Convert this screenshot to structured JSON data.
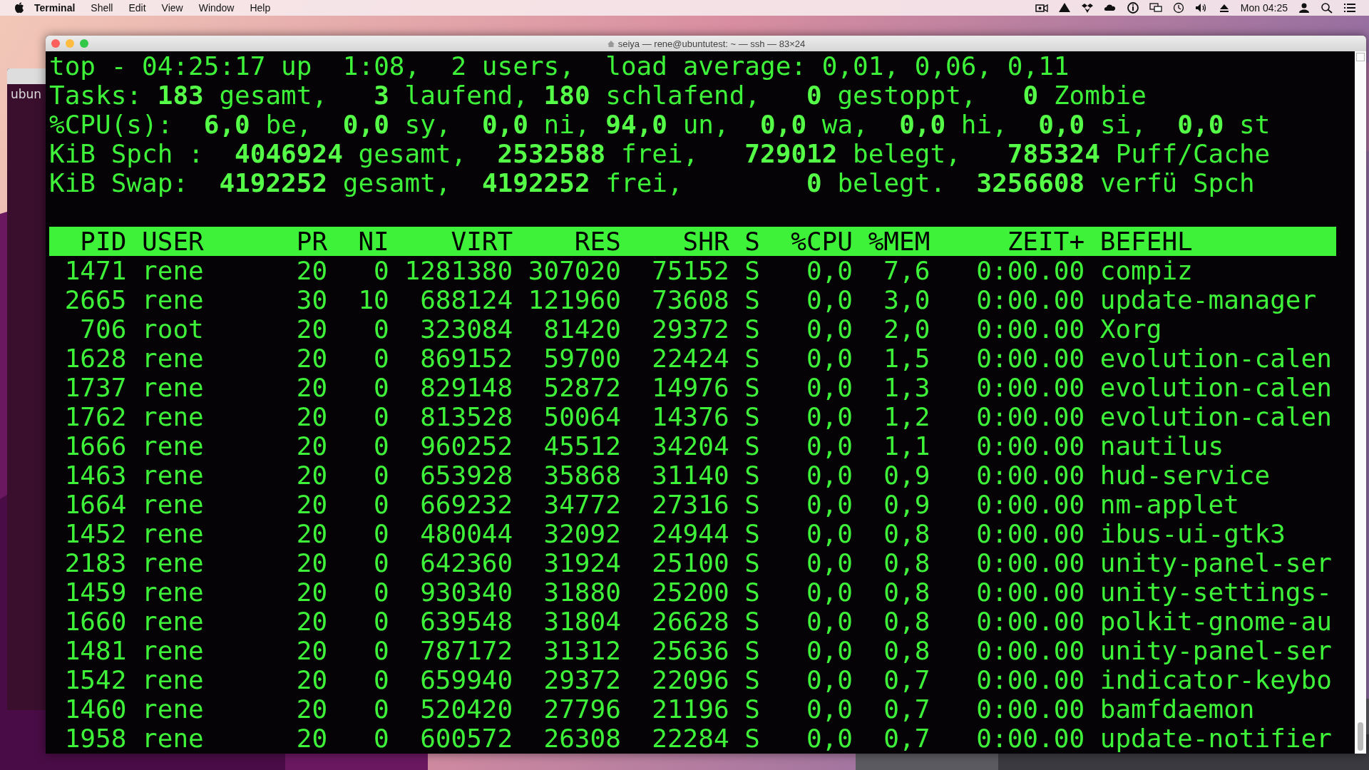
{
  "menu_bar": {
    "app": "Terminal",
    "items": [
      "Shell",
      "Edit",
      "View",
      "Window",
      "Help"
    ],
    "clock": "Mon 04:25"
  },
  "background_window": {
    "text": "ubun"
  },
  "window": {
    "title": "seiya — rene@ubuntutest: ~ — ssh — 83×24"
  },
  "summary": [
    "top - 04:25:17 up  1:08,  2 users,  load average: 0,01, 0,06, 0,11",
    "Tasks: **183** gesamt,   **3** laufend, **180** schlafend,   **0** gestoppt,   **0** Zombie",
    "%CPU(s):  **6,0** be,  **0,0** sy,  **0,0** ni, **94,0** un,  **0,0** wa,  **0,0** hi,  **0,0** si,  **0,0** st",
    "KiB Spch :  **4046924** gesamt,  **2532588** frei,   **729012** belegt,   **785324** Puff/Cache",
    "KiB Swap:  **4192252** gesamt,  **4192252** frei,        **0** belegt.  **3256608** verfü Spch"
  ],
  "table": {
    "columns": [
      "PID",
      "USER",
      "PR",
      "NI",
      "VIRT",
      "RES",
      "SHR",
      "S",
      "%CPU",
      "%MEM",
      "ZEIT+",
      "BEFEHL"
    ],
    "rows": [
      [
        "1471",
        "rene",
        "20",
        "0",
        "1281380",
        "307020",
        "75152",
        "S",
        "0,0",
        "7,6",
        "0:00.00",
        "compiz"
      ],
      [
        "2665",
        "rene",
        "30",
        "10",
        "688124",
        "121960",
        "73608",
        "S",
        "0,0",
        "3,0",
        "0:00.00",
        "update-manager"
      ],
      [
        "706",
        "root",
        "20",
        "0",
        "323084",
        "81420",
        "29372",
        "S",
        "0,0",
        "2,0",
        "0:00.00",
        "Xorg"
      ],
      [
        "1628",
        "rene",
        "20",
        "0",
        "869152",
        "59700",
        "22424",
        "S",
        "0,0",
        "1,5",
        "0:00.00",
        "evolution-calen"
      ],
      [
        "1737",
        "rene",
        "20",
        "0",
        "829148",
        "52872",
        "14976",
        "S",
        "0,0",
        "1,3",
        "0:00.00",
        "evolution-calen"
      ],
      [
        "1762",
        "rene",
        "20",
        "0",
        "813528",
        "50064",
        "14376",
        "S",
        "0,0",
        "1,2",
        "0:00.00",
        "evolution-calen"
      ],
      [
        "1666",
        "rene",
        "20",
        "0",
        "960252",
        "45512",
        "34204",
        "S",
        "0,0",
        "1,1",
        "0:00.00",
        "nautilus"
      ],
      [
        "1463",
        "rene",
        "20",
        "0",
        "653928",
        "35868",
        "31140",
        "S",
        "0,0",
        "0,9",
        "0:00.00",
        "hud-service"
      ],
      [
        "1664",
        "rene",
        "20",
        "0",
        "669232",
        "34772",
        "27316",
        "S",
        "0,0",
        "0,9",
        "0:00.00",
        "nm-applet"
      ],
      [
        "1452",
        "rene",
        "20",
        "0",
        "480044",
        "32092",
        "24944",
        "S",
        "0,0",
        "0,8",
        "0:00.00",
        "ibus-ui-gtk3"
      ],
      [
        "2183",
        "rene",
        "20",
        "0",
        "642360",
        "31924",
        "25100",
        "S",
        "0,0",
        "0,8",
        "0:00.00",
        "unity-panel-ser"
      ],
      [
        "1459",
        "rene",
        "20",
        "0",
        "930340",
        "31880",
        "25200",
        "S",
        "0,0",
        "0,8",
        "0:00.00",
        "unity-settings-"
      ],
      [
        "1660",
        "rene",
        "20",
        "0",
        "639548",
        "31804",
        "26628",
        "S",
        "0,0",
        "0,8",
        "0:00.00",
        "polkit-gnome-au"
      ],
      [
        "1481",
        "rene",
        "20",
        "0",
        "787172",
        "31312",
        "25636",
        "S",
        "0,0",
        "0,8",
        "0:00.00",
        "unity-panel-ser"
      ],
      [
        "1542",
        "rene",
        "20",
        "0",
        "659940",
        "29372",
        "22096",
        "S",
        "0,0",
        "0,7",
        "0:00.00",
        "indicator-keybo"
      ],
      [
        "1460",
        "rene",
        "20",
        "0",
        "520420",
        "27796",
        "21196",
        "S",
        "0,0",
        "0,7",
        "0:00.00",
        "bamfdaemon"
      ],
      [
        "1958",
        "rene",
        "20",
        "0",
        "600572",
        "26308",
        "22284",
        "S",
        "0,0",
        "0,7",
        "0:00.00",
        "update-notifier"
      ]
    ]
  }
}
